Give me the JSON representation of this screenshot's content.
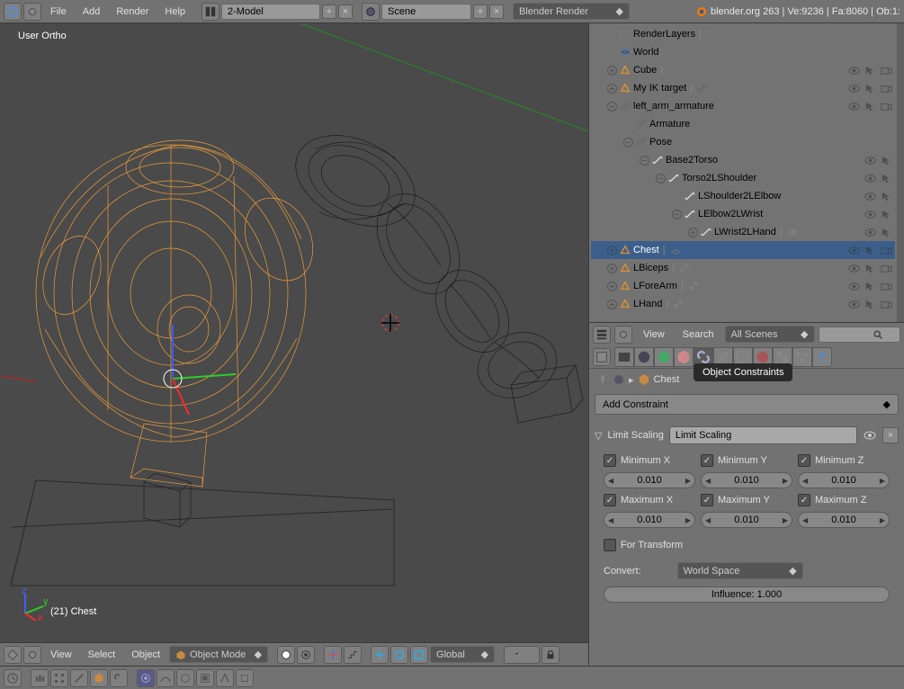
{
  "top_menu": {
    "file": "File",
    "add": "Add",
    "render": "Render",
    "help": "Help"
  },
  "layout_field": "2-Model",
  "scene_field": "Scene",
  "renderer_field": "Blender Render",
  "version": "blender.org 263 | Ve:9236 | Fa:8060 | Ob:1:",
  "viewport": {
    "label": "User Ortho",
    "object": "(21) Chest"
  },
  "outliner": {
    "items": [
      {
        "indent": 0,
        "expand": "",
        "icon": "scene",
        "label": "RenderLayers",
        "extra": "layer"
      },
      {
        "indent": 0,
        "expand": "",
        "icon": "world",
        "label": "World"
      },
      {
        "indent": 0,
        "expand": "plus",
        "icon": "tri",
        "label": "Cube",
        "extra": "meshlink",
        "eye": true,
        "cur": true,
        "cam": true
      },
      {
        "indent": 0,
        "expand": "plus",
        "icon": "tri",
        "label": "My IK target",
        "extra": "arm",
        "eye": true,
        "cur": true,
        "cam": true
      },
      {
        "indent": 0,
        "expand": "minus",
        "icon": "arm",
        "label": "left_arm_armature",
        "eye": true,
        "cur": true,
        "cam": true
      },
      {
        "indent": 1,
        "expand": "",
        "icon": "arm",
        "label": "Armature"
      },
      {
        "indent": 1,
        "expand": "minus",
        "icon": "arm",
        "label": "Pose"
      },
      {
        "indent": 2,
        "expand": "minus",
        "icon": "bone",
        "label": "Base2Torso",
        "eye": true,
        "cur": true
      },
      {
        "indent": 3,
        "expand": "minus",
        "icon": "bone",
        "label": "Torso2LShoulder",
        "eye": true,
        "cur": true
      },
      {
        "indent": 4,
        "expand": "",
        "icon": "bone",
        "label": "LShoulder2LElbow",
        "eye": true,
        "cur": true
      },
      {
        "indent": 4,
        "expand": "minus",
        "icon": "bone",
        "label": "LElbow2LWrist",
        "eye": true,
        "cur": true
      },
      {
        "indent": 5,
        "expand": "plus",
        "icon": "bone",
        "label": "LWrist2LHand",
        "extra": "chain",
        "eye": true,
        "cur": true
      },
      {
        "indent": 0,
        "expand": "plus",
        "icon": "tri",
        "label": "Chest",
        "sel": true,
        "extra": "meshlink",
        "eye": true,
        "cur": true,
        "cam": true
      },
      {
        "indent": 0,
        "expand": "plus",
        "icon": "tri",
        "label": "LBiceps",
        "extra": "arm2",
        "eye": true,
        "cur": true,
        "cam": true
      },
      {
        "indent": 0,
        "expand": "plus",
        "icon": "tri",
        "label": "LForeArm",
        "extra": "arm2",
        "eye": true,
        "cur": true,
        "cam": true
      },
      {
        "indent": 0,
        "expand": "plus",
        "icon": "tri",
        "label": "LHand",
        "extra": "arm2",
        "eye": true,
        "cur": true,
        "cam": true
      }
    ],
    "footer": {
      "view": "View",
      "search": "Search",
      "scope": "All Scenes"
    }
  },
  "breadcrumb": {
    "object": "Chest",
    "tooltip": "Object Constraints"
  },
  "props": {
    "add_constraint": "Add Constraint",
    "panel_title": "Limit Scaling",
    "panel_name": "Limit Scaling",
    "min_x": "Minimum X",
    "min_y": "Minimum Y",
    "min_z": "Minimum Z",
    "max_x": "Maximum X",
    "max_y": "Maximum Y",
    "max_z": "Maximum Z",
    "val": "0.010",
    "for_transform": "For Transform",
    "convert_label": "Convert:",
    "convert_value": "World Space",
    "influence": "Influence: 1.000"
  },
  "viewport_footer": {
    "view": "View",
    "select": "Select",
    "object": "Object",
    "mode": "Object Mode",
    "orient": "Global"
  }
}
